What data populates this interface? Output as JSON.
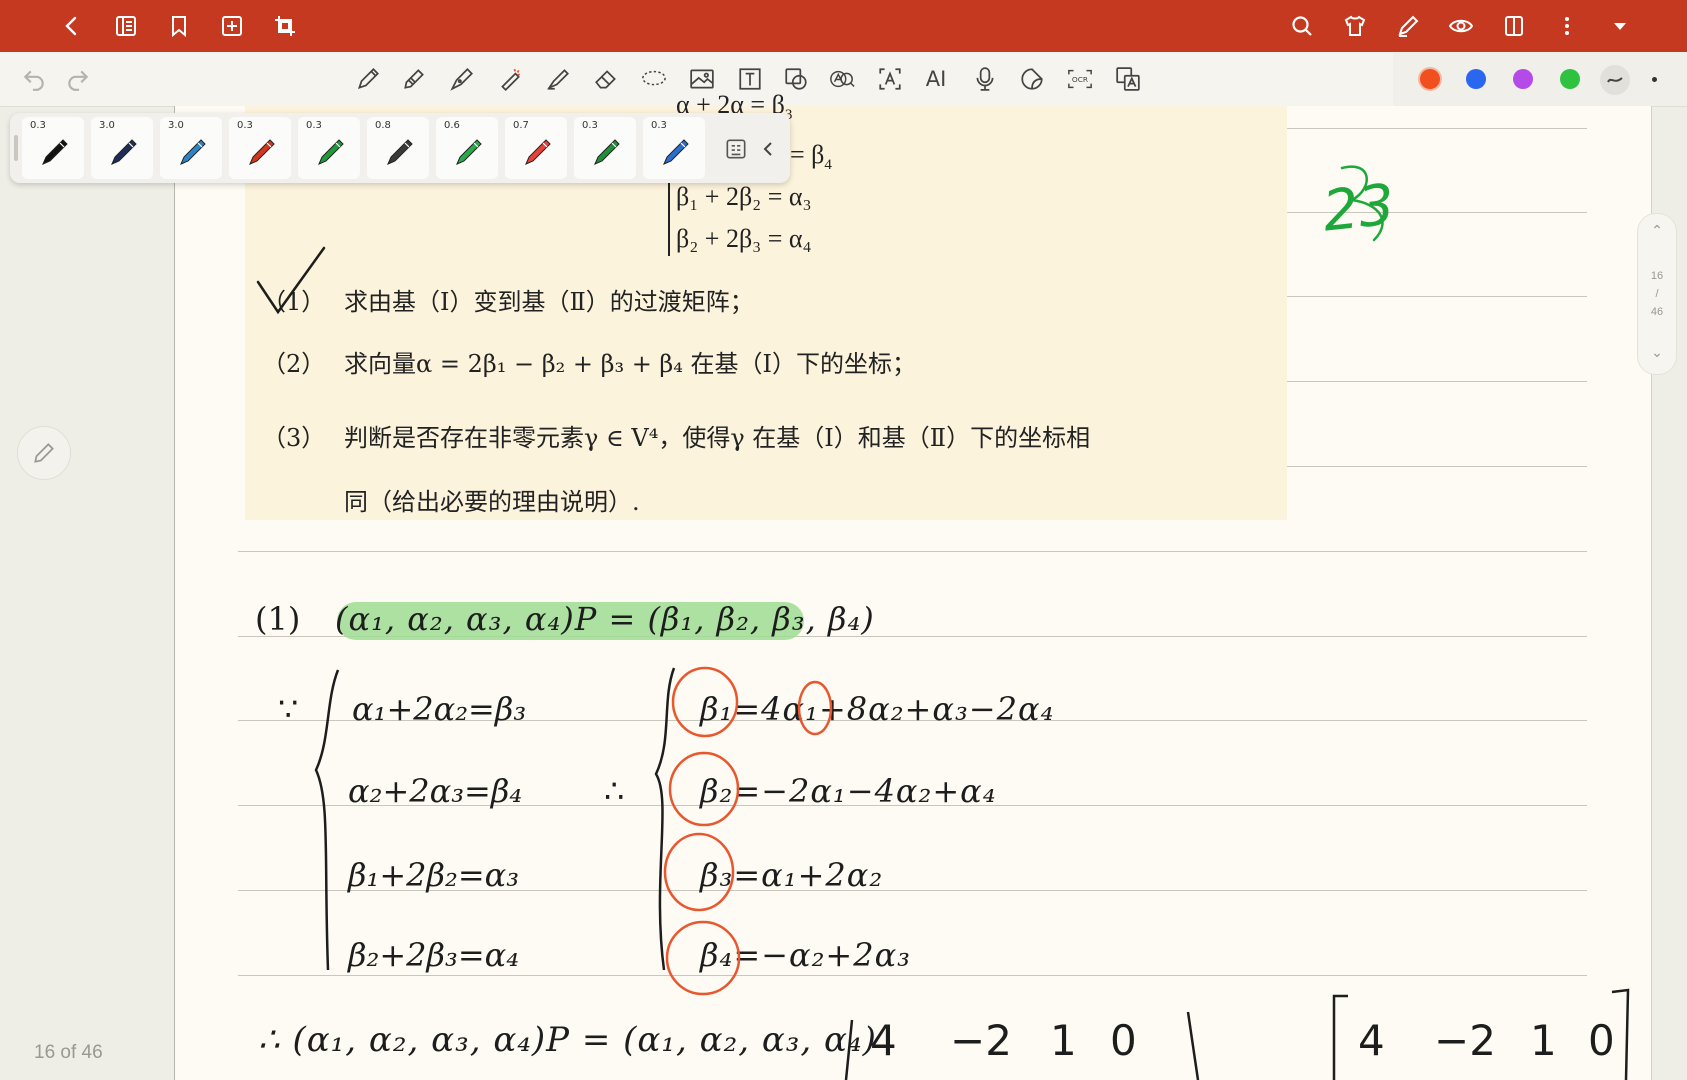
{
  "topbar": {
    "icons": [
      "back-icon",
      "outline-icon",
      "bookmark-icon",
      "add-page-icon",
      "crop-icon",
      "search-icon",
      "shirt-icon",
      "pen-edit-icon",
      "eye-icon",
      "split-view-icon",
      "more-icon",
      "dropdown-icon"
    ]
  },
  "toolbar": {
    "ai_label": "AI",
    "ocr_label": "OCR",
    "tools": [
      "pen",
      "pencil",
      "fountain-pen",
      "marker-eraser",
      "highlighter",
      "eraser",
      "lasso",
      "image",
      "text-box",
      "shape",
      "search-text",
      "text-recognition",
      "ai",
      "microphone",
      "sticker",
      "ocr",
      "translate"
    ]
  },
  "colors": [
    "#f24f1e",
    "#2b66f0",
    "#b44ae8",
    "#2ec240",
    "#555555"
  ],
  "pens": [
    {
      "size": "0.3",
      "color": "#111111"
    },
    {
      "size": "3.0",
      "color": "#1e2c5a"
    },
    {
      "size": "3.0",
      "color": "#2a85c6"
    },
    {
      "size": "0.3",
      "color": "#d6361f"
    },
    {
      "size": "0.3",
      "color": "#1f9a3c"
    },
    {
      "size": "0.8",
      "color": "#3a3a3a"
    },
    {
      "size": "0.6",
      "color": "#2aa84a"
    },
    {
      "size": "0.7",
      "color": "#e8413a"
    },
    {
      "size": "0.3",
      "color": "#1f8f3a"
    },
    {
      "size": "0.3",
      "color": "#2a6fd0"
    }
  ],
  "page_indicator": "16 of 46",
  "scroller": {
    "current": "16",
    "sep": "/",
    "total": "46"
  },
  "problem": {
    "eq_top_partial": "α + 2α = β",
    "eq_top_sub": "3",
    "eq2_partial": "= β",
    "eq2_sub": "4",
    "eq3": "β₁ + 2β₂ = α₃",
    "eq4": "β₂ + 2β₃ = α₄",
    "q1_num": "（1）",
    "q1_text": "求由基（Ⅰ）变到基（Ⅱ）的过渡矩阵；",
    "q2_num": "（2）",
    "q2_text": "求向量α = 2β₁ − β₂ + β₃ + β₄ 在基（Ⅰ）下的坐标；",
    "q3_num": "（3）",
    "q3_text": "判断是否存在非零元素γ ∈ V⁴，使得γ 在基（Ⅰ）和基（Ⅱ）下的坐标相",
    "q3_text2": "同（给出必要的理由说明）."
  },
  "handwriting": {
    "margin_note": "23",
    "part_label": "(1)",
    "part1": "(α₁, α₂, α₃, α₄)P = (β₁, β₂, β₃, β₄)",
    "because": "∵",
    "left_system": [
      "α₁+2α₂=β₃",
      "α₂+2α₃=β₄",
      "β₁+2β₂=α₃",
      "β₂+2β₃=α₄"
    ],
    "therefore": "∴",
    "right_system": [
      "β₁=4α₁+8α₂+α₃−2α₄",
      "β₂=−2α₁−4α₂+α₄",
      "β₃=α₁+2α₂",
      "β₄=−α₂+2α₃"
    ],
    "bottom_line": "∴ (α₁, α₂, α₃, α₄)P = (α₁, α₂, α₃, α₄)",
    "matrix_row1_left": [
      "4",
      "−2",
      "1",
      "0"
    ],
    "matrix_row1_right": [
      "4",
      "−2",
      "1",
      "0"
    ]
  }
}
